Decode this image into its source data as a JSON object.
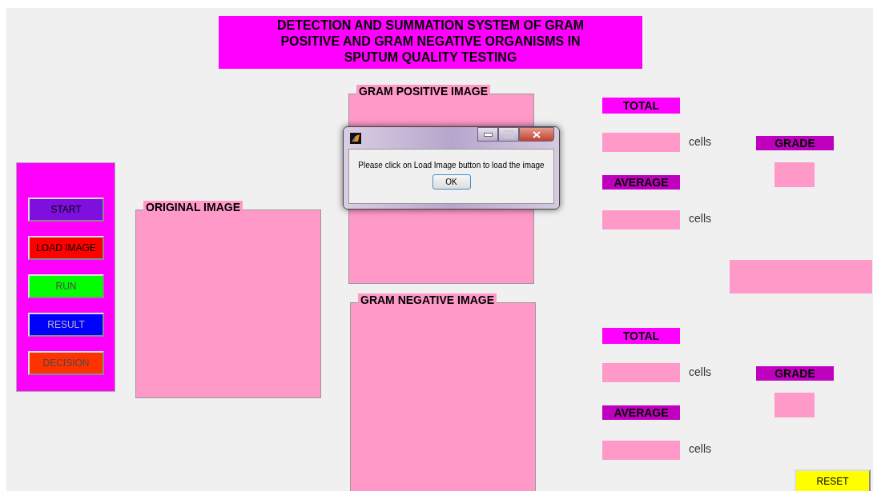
{
  "title": "DETECTION AND SUMMATION SYSTEM OF GRAM POSITIVE AND GRAM NEGATIVE ORGANISMS IN SPUTUM QUALITY TESTING",
  "control_buttons": [
    {
      "label": "START",
      "color": "#7f0fdf",
      "disabled": false
    },
    {
      "label": "LOAD IMAGE",
      "color": "#ff0000",
      "disabled": false
    },
    {
      "label": "RUN",
      "color": "#00ff00",
      "disabled": true
    },
    {
      "label": "RESULT",
      "color": "#0000ff",
      "disabled": true
    },
    {
      "label": "DECISION",
      "color": "#ff3300",
      "disabled": true
    }
  ],
  "image_panels": [
    {
      "label": "ORIGINAL IMAGE"
    },
    {
      "label": "GRAM POSITIVE IMAGE"
    },
    {
      "label": "GRAM NEGATIVE IMAGE"
    }
  ],
  "result_groups": [
    {
      "total_label": "TOTAL",
      "total_unit": "cells",
      "average_label": "AVERAGE",
      "average_unit": "cells",
      "grade_label": "GRADE"
    },
    {
      "total_label": "TOTAL",
      "total_unit": "cells",
      "average_label": "AVERAGE",
      "average_unit": "cells",
      "grade_label": "GRADE"
    }
  ],
  "reset_button": "RESET",
  "dialog": {
    "message": "Please click on Load Image button to load the image",
    "ok_button": "OK"
  }
}
